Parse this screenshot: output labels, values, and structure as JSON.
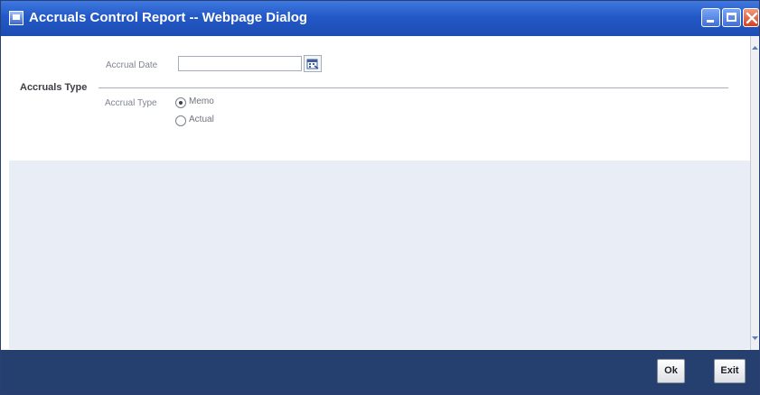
{
  "window": {
    "title": "Accruals Control Report -- Webpage Dialog"
  },
  "form": {
    "accrual_date_label": "Accrual Date",
    "accrual_date_value": "",
    "section_title": "Accruals Type",
    "accrual_type_label": "Accrual Type",
    "options": [
      {
        "label": "Memo",
        "selected": true
      },
      {
        "label": "Actual",
        "selected": false
      }
    ]
  },
  "footer": {
    "ok_label": "Ok",
    "exit_label": "Exit"
  },
  "colors": {
    "titlebar": "#2358c6",
    "footer": "#253f6e",
    "content_bg": "#e9eef6"
  }
}
